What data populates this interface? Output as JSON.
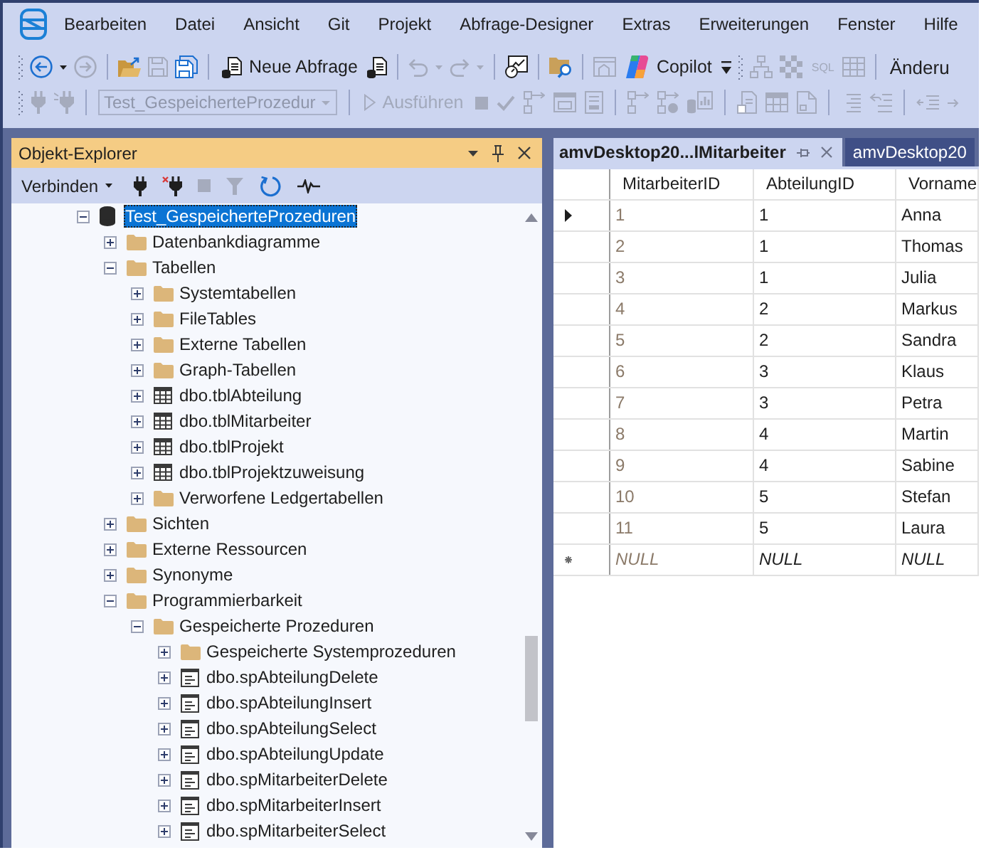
{
  "menu_bar": {
    "items": [
      "Bearbeiten",
      "Datei",
      "Ansicht",
      "Git",
      "Projekt",
      "Abfrage-Designer",
      "Extras",
      "Erweiterungen",
      "Fenster",
      "Hilfe"
    ]
  },
  "standard_toolbar": {
    "new_query": {
      "label": "Neue Abfrage"
    },
    "copilot": {
      "label": "Copilot"
    },
    "sql_button": {
      "label": "SQL",
      "disabled": true
    },
    "trailing_button": {
      "label": "Änderu"
    }
  },
  "query_toolbar": {
    "database": {
      "value": "Test_GespeicherteProzedur",
      "disabled": true
    },
    "execute": {
      "label": "Ausführen",
      "disabled": true
    }
  },
  "object_explorer": {
    "title": "Objekt-Explorer",
    "connect": {
      "label": "Verbinden"
    },
    "tree": [
      {
        "label": "Test_GespeicherteProzeduren",
        "kind": "database",
        "expanded": true,
        "selected": true,
        "children": [
          {
            "label": "Datenbankdiagramme",
            "kind": "folder",
            "expanded": false,
            "selected": false
          },
          {
            "label": "Tabellen",
            "kind": "folder",
            "expanded": true,
            "selected": false,
            "children": [
              {
                "label": "Systemtabellen",
                "kind": "folder",
                "expanded": false,
                "selected": false
              },
              {
                "label": "FileTables",
                "kind": "folder",
                "expanded": false,
                "selected": false
              },
              {
                "label": "Externe Tabellen",
                "kind": "folder",
                "expanded": false,
                "selected": false
              },
              {
                "label": "Graph-Tabellen",
                "kind": "folder",
                "expanded": false,
                "selected": false
              },
              {
                "label": "dbo.tblAbteilung",
                "kind": "table",
                "expanded": false,
                "selected": false
              },
              {
                "label": "dbo.tblMitarbeiter",
                "kind": "table",
                "expanded": false,
                "selected": false
              },
              {
                "label": "dbo.tblProjekt",
                "kind": "table",
                "expanded": false,
                "selected": false
              },
              {
                "label": "dbo.tblProjektzuweisung",
                "kind": "table",
                "expanded": false,
                "selected": false
              },
              {
                "label": "Verworfene Ledgertabellen",
                "kind": "folder",
                "expanded": false,
                "selected": false
              }
            ]
          },
          {
            "label": "Sichten",
            "kind": "folder",
            "expanded": false,
            "selected": false
          },
          {
            "label": "Externe Ressourcen",
            "kind": "folder",
            "expanded": false,
            "selected": false
          },
          {
            "label": "Synonyme",
            "kind": "folder",
            "expanded": false,
            "selected": false
          },
          {
            "label": "Programmierbarkeit",
            "kind": "folder",
            "expanded": true,
            "selected": false,
            "children": [
              {
                "label": "Gespeicherte Prozeduren",
                "kind": "folder",
                "expanded": true,
                "selected": false,
                "children": [
                  {
                    "label": "Gespeicherte Systemprozeduren",
                    "kind": "folder",
                    "expanded": false,
                    "selected": false
                  },
                  {
                    "label": "dbo.spAbteilungDelete",
                    "kind": "procedure",
                    "expanded": false,
                    "selected": false
                  },
                  {
                    "label": "dbo.spAbteilungInsert",
                    "kind": "procedure",
                    "expanded": false,
                    "selected": false
                  },
                  {
                    "label": "dbo.spAbteilungSelect",
                    "kind": "procedure",
                    "expanded": false,
                    "selected": false
                  },
                  {
                    "label": "dbo.spAbteilungUpdate",
                    "kind": "procedure",
                    "expanded": false,
                    "selected": false
                  },
                  {
                    "label": "dbo.spMitarbeiterDelete",
                    "kind": "procedure",
                    "expanded": false,
                    "selected": false
                  },
                  {
                    "label": "dbo.spMitarbeiterInsert",
                    "kind": "procedure",
                    "expanded": false,
                    "selected": false
                  },
                  {
                    "label": "dbo.spMitarbeiterSelect",
                    "kind": "procedure",
                    "expanded": false,
                    "selected": false
                  }
                ]
              }
            ]
          }
        ]
      }
    ]
  },
  "document_tabs": [
    {
      "label": "amvDesktop20...lMitarbeiter",
      "selected": true
    },
    {
      "label": "amvDesktop20",
      "selected": false
    }
  ],
  "grid": {
    "columns": [
      {
        "label": "MitarbeiterID",
        "read_only": true
      },
      {
        "label": "AbteilungID",
        "read_only": false
      },
      {
        "label": "Vorname",
        "read_only": false
      }
    ],
    "rows": [
      {
        "kind": "data",
        "selected": true,
        "cells": [
          "1",
          "1",
          "Anna"
        ]
      },
      {
        "kind": "data",
        "selected": false,
        "cells": [
          "2",
          "1",
          "Thomas"
        ]
      },
      {
        "kind": "data",
        "selected": false,
        "cells": [
          "3",
          "1",
          "Julia"
        ]
      },
      {
        "kind": "data",
        "selected": false,
        "cells": [
          "4",
          "2",
          "Markus"
        ]
      },
      {
        "kind": "data",
        "selected": false,
        "cells": [
          "5",
          "2",
          "Sandra"
        ]
      },
      {
        "kind": "data",
        "selected": false,
        "cells": [
          "6",
          "3",
          "Klaus"
        ]
      },
      {
        "kind": "data",
        "selected": false,
        "cells": [
          "7",
          "3",
          "Petra"
        ]
      },
      {
        "kind": "data",
        "selected": false,
        "cells": [
          "8",
          "4",
          "Martin"
        ]
      },
      {
        "kind": "data",
        "selected": false,
        "cells": [
          "9",
          "4",
          "Sabine"
        ]
      },
      {
        "kind": "data",
        "selected": false,
        "cells": [
          "10",
          "5",
          "Stefan"
        ]
      },
      {
        "kind": "data",
        "selected": false,
        "cells": [
          "11",
          "5",
          "Laura"
        ]
      },
      {
        "kind": "new",
        "selected": false,
        "cells": [
          "NULL",
          "NULL",
          "NULL"
        ]
      }
    ]
  }
}
